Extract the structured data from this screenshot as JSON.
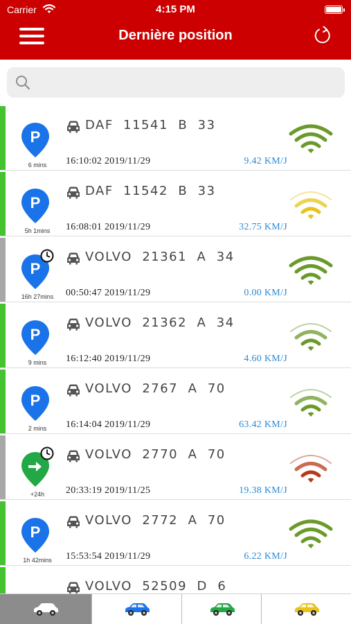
{
  "status_bar": {
    "carrier": "Carrier",
    "time": "4:15 PM"
  },
  "header": {
    "title": "Dernière position",
    "menu_icon": "hamburger-menu-icon",
    "refresh_icon": "refresh-icon",
    "background": "#cc0000"
  },
  "search": {
    "placeholder": "",
    "value": "",
    "icon": "search-icon"
  },
  "vehicles": [
    {
      "name": "DAF  11541  B  33",
      "time": "16:10:02  2019/11/29",
      "speed": "9.42  KM/J",
      "duration": "6 mins",
      "status_color": "#44c22f",
      "pin": "parking",
      "pin_color": "#1a73e8",
      "clock": false,
      "signal_color": "#6a9a2a",
      "signal_faded": false
    },
    {
      "name": "DAF  11542  B  33",
      "time": "16:08:01  2019/11/29",
      "speed": "32.75  KM/J",
      "duration": "5h 1mins",
      "status_color": "#44c22f",
      "pin": "parking",
      "pin_color": "#1a73e8",
      "clock": false,
      "signal_color": "#e8c31a",
      "signal_faded": true
    },
    {
      "name": "VOLVO  21361  A  34",
      "time": "00:50:47  2019/11/29",
      "speed": "0.00  KM/J",
      "duration": "16h 27mins",
      "status_color": "#a8a8a8",
      "pin": "parking",
      "pin_color": "#1a73e8",
      "clock": true,
      "signal_color": "#6a9a2a",
      "signal_faded": false
    },
    {
      "name": "VOLVO  21362  A  34",
      "time": "16:12:40  2019/11/29",
      "speed": "4.60  KM/J",
      "duration": "9 mins",
      "status_color": "#44c22f",
      "pin": "parking",
      "pin_color": "#1a73e8",
      "clock": false,
      "signal_color": "#6a9a2a",
      "signal_faded": true
    },
    {
      "name": "VOLVO  2767  A  70",
      "time": "16:14:04  2019/11/29",
      "speed": "63.42  KM/J",
      "duration": "2 mins",
      "status_color": "#44c22f",
      "pin": "parking",
      "pin_color": "#1a73e8",
      "clock": false,
      "signal_color": "#6a9a2a",
      "signal_faded": true
    },
    {
      "name": "VOLVO  2770  A  70",
      "time": "20:33:19  2019/11/25",
      "speed": "19.38  KM/J",
      "duration": "+24h",
      "status_color": "#a8a8a8",
      "pin": "moving",
      "pin_color": "#22a845",
      "clock": true,
      "signal_color": "#b83a1a",
      "signal_faded": true
    },
    {
      "name": "VOLVO  2772  A  70",
      "time": "15:53:54  2019/11/29",
      "speed": "6.22  KM/J",
      "duration": "1h 42mins",
      "status_color": "#44c22f",
      "pin": "parking",
      "pin_color": "#1a73e8",
      "clock": false,
      "signal_color": "#6a9a2a",
      "signal_faded": false
    },
    {
      "name": "VOLVO  52509  D  6",
      "time": "",
      "speed": "",
      "duration": "",
      "status_color": "#44c22f",
      "pin": "partial",
      "pin_color": "#e8c31a",
      "clock": false,
      "signal_color": "#6a9a2a",
      "signal_faded": false
    }
  ],
  "tabs": [
    {
      "name": "tab-all-vehicles",
      "icon": "car-icon-white",
      "color": "#ffffff",
      "active": true
    },
    {
      "name": "tab-parked-vehicles",
      "icon": "car-icon-blue",
      "color": "#1a73e8",
      "active": false
    },
    {
      "name": "tab-moving-vehicles",
      "icon": "car-icon-green",
      "color": "#22a845",
      "active": false
    },
    {
      "name": "tab-idle-vehicles",
      "icon": "car-icon-yellow",
      "color": "#e8c31a",
      "active": false
    }
  ]
}
